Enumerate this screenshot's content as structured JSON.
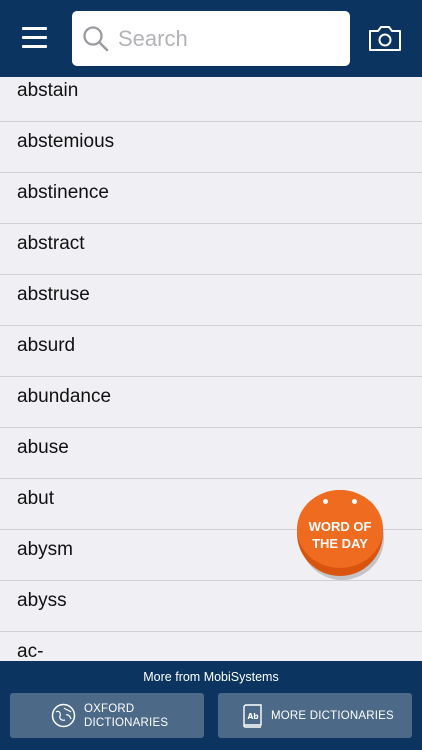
{
  "search": {
    "placeholder": "Search",
    "value": ""
  },
  "words": [
    "abstain",
    "abstemious",
    "abstinence",
    "abstract",
    "abstruse",
    "absurd",
    "abundance",
    "abuse",
    "abut",
    "abysm",
    "abyss",
    "ac-"
  ],
  "word_of_the_day": {
    "line1": "WORD OF",
    "line2": "THE DAY"
  },
  "footer": {
    "caption": "More from MobiSystems",
    "oxford_line1": "OXFORD",
    "oxford_line2": "DICTIONARIES",
    "more_label": "MORE DICTIONARIES"
  },
  "icons": {
    "menu": "menu-icon",
    "search": "search-icon",
    "camera": "camera-icon",
    "oxford": "globe-icon",
    "more": "dictionary-book-icon"
  },
  "colors": {
    "bar": "#0b3560",
    "list_bg": "#efeff4",
    "accent": "#ee6b1f",
    "button": "#4c6a88"
  }
}
